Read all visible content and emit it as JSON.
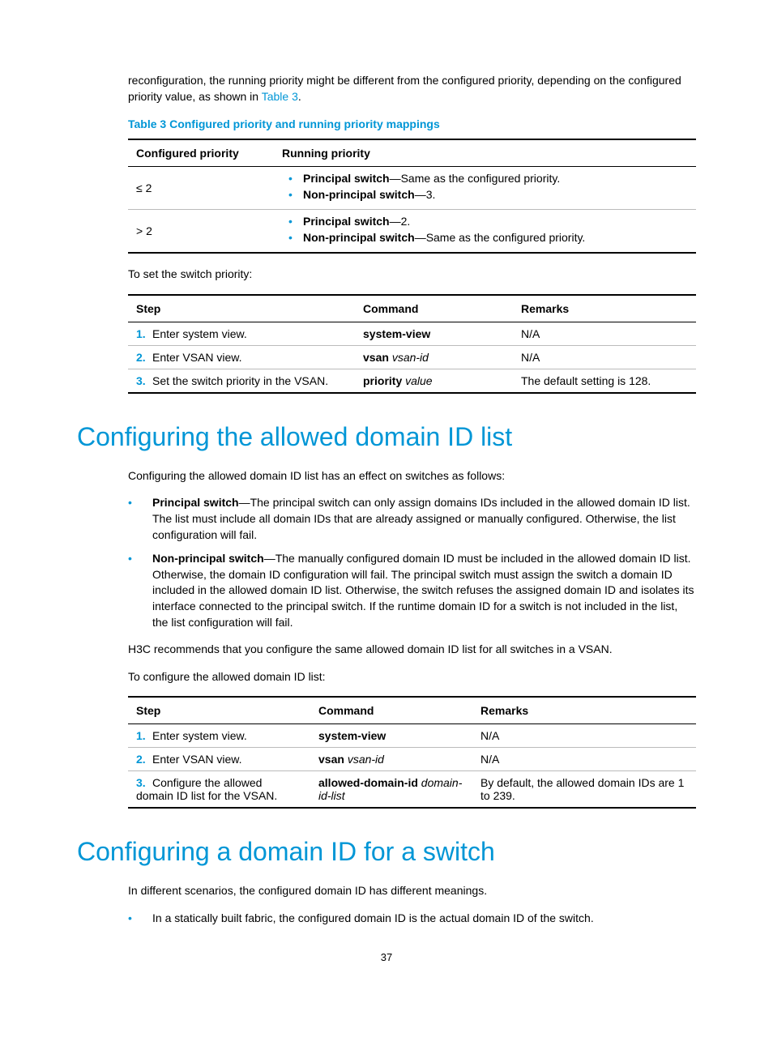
{
  "intro": {
    "p1a": "reconfiguration, the running priority might be different from the configured priority, depending on the configured priority value, as shown in ",
    "t3link": "Table 3",
    "p1b": "."
  },
  "table3": {
    "caption": "Table 3 Configured priority and running priority mappings",
    "headers": {
      "c1": "Configured priority",
      "c2": "Running priority"
    },
    "rows": [
      {
        "cp": "≤ 2",
        "a_bold": "Principal switch",
        "a_rest": "—Same as the configured priority.",
        "b_bold": "Non-principal switch",
        "b_rest": "—3."
      },
      {
        "cp": "> 2",
        "a_bold": "Principal switch",
        "a_rest": "—2.",
        "b_bold": "Non-principal switch",
        "b_rest": "—Same as the configured priority."
      }
    ]
  },
  "steps1": {
    "intro": "To set the switch priority:",
    "headers": {
      "c1": "Step",
      "c2": "Command",
      "c3": "Remarks"
    },
    "rows": [
      {
        "n": "1.",
        "step": "Enter system view.",
        "cmd_b": "system-view",
        "cmd_i": "",
        "rem": "N/A"
      },
      {
        "n": "2.",
        "step": "Enter VSAN view.",
        "cmd_b": "vsan",
        "cmd_i": "vsan-id",
        "rem": "N/A"
      },
      {
        "n": "3.",
        "step": "Set the switch priority in the VSAN.",
        "cmd_b": "priority",
        "cmd_i": "value",
        "rem": "The default setting is 128."
      }
    ]
  },
  "h1a": "Configuring the allowed domain ID list",
  "sectA": {
    "p1": "Configuring the allowed domain ID list has an effect on switches as follows:",
    "b1_bold": "Principal switch",
    "b1_rest": "—The principal switch can only assign domains IDs included in the allowed domain ID list. The list must include all domain IDs that are already assigned or manually configured. Otherwise, the list configuration will fail.",
    "b2_bold": "Non-principal switch",
    "b2_rest": "—The manually configured domain ID must be included in the allowed domain ID list. Otherwise, the domain ID configuration will fail. The principal switch must assign the switch a domain ID included in the allowed domain ID list. Otherwise, the switch refuses the assigned domain ID and isolates its interface connected to the principal switch. If the runtime domain ID for a switch is not included in the list, the list configuration will fail.",
    "p2": "H3C recommends that you configure the same allowed domain ID list for all switches in a VSAN.",
    "p3": "To configure the allowed domain ID list:"
  },
  "steps2": {
    "headers": {
      "c1": "Step",
      "c2": "Command",
      "c3": "Remarks"
    },
    "rows": [
      {
        "n": "1.",
        "step": "Enter system view.",
        "cmd_b": "system-view",
        "cmd_i": "",
        "rem": "N/A"
      },
      {
        "n": "2.",
        "step": "Enter VSAN view.",
        "cmd_b": "vsan",
        "cmd_i": "vsan-id",
        "rem": "N/A"
      },
      {
        "n": "3.",
        "step": "Configure the allowed domain ID list for the VSAN.",
        "cmd_b": "allowed-domain-id",
        "cmd_i": "domain-id-list",
        "rem": "By default, the allowed domain IDs are 1 to 239."
      }
    ]
  },
  "h1b": "Configuring a domain ID for a switch",
  "sectB": {
    "p1": "In different scenarios, the configured domain ID has different meanings.",
    "b1": "In a statically built fabric, the configured domain ID is the actual domain ID of the switch."
  },
  "pageNum": "37"
}
